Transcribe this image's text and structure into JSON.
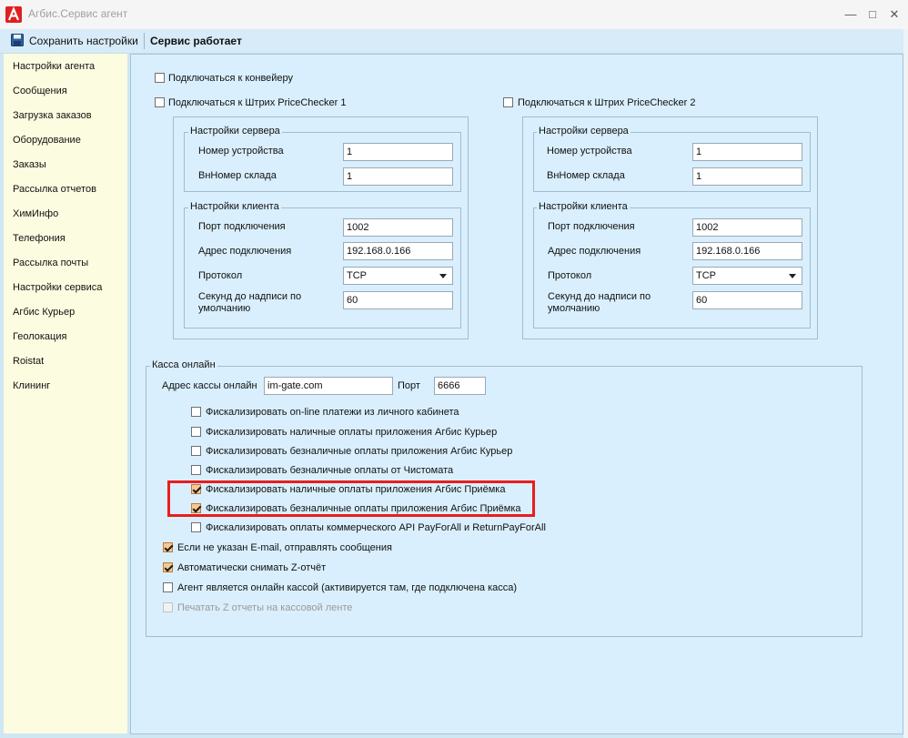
{
  "window": {
    "title": "Агбис.Сервис агент",
    "minimize": "—",
    "maximize": "□",
    "close": "✕"
  },
  "toolbar": {
    "save_label": "Сохранить настройки",
    "status": "Сервис работает"
  },
  "sidebar": {
    "items": [
      {
        "label": "Настройки агента"
      },
      {
        "label": "Сообщения"
      },
      {
        "label": "Загрузка заказов"
      },
      {
        "label": "Оборудование"
      },
      {
        "label": "Заказы"
      },
      {
        "label": "Рассылка отчетов"
      },
      {
        "label": "ХимИнфо"
      },
      {
        "label": "Телефония"
      },
      {
        "label": "Рассылка почты"
      },
      {
        "label": "Настройки сервиса"
      },
      {
        "label": "Агбис Курьер"
      },
      {
        "label": "Геолокация"
      },
      {
        "label": "Roistat"
      },
      {
        "label": "Клининг"
      }
    ]
  },
  "conveyor": {
    "label": "Подключаться к конвейеру",
    "checked": false
  },
  "pc1": {
    "label": "Подключаться к Штрих PriceChecker 1",
    "checked": false,
    "server": {
      "title": "Настройки сервера",
      "device_label": "Номер устройства",
      "device_value": "1",
      "warehouse_label": "ВнНомер склада",
      "warehouse_value": "1"
    },
    "client": {
      "title": "Настройки клиента",
      "port_label": "Порт подключения",
      "port_value": "1002",
      "addr_label": "Адрес подключения",
      "addr_value": "192.168.0.166",
      "proto_label": "Протокол",
      "proto_value": "TCP",
      "sec_label_1": "Секунд до надписи по",
      "sec_label_2": "умолчанию",
      "sec_value": "60"
    }
  },
  "pc2": {
    "label": "Подключаться к Штрих PriceChecker 2",
    "checked": false,
    "server": {
      "title": "Настройки сервера",
      "device_label": "Номер устройства",
      "device_value": "1",
      "warehouse_label": "ВнНомер склада",
      "warehouse_value": "1"
    },
    "client": {
      "title": "Настройки клиента",
      "port_label": "Порт подключения",
      "port_value": "1002",
      "addr_label": "Адрес подключения",
      "addr_value": "192.168.0.166",
      "proto_label": "Протокол",
      "proto_value": "TCP",
      "sec_label_1": "Секунд до надписи по",
      "sec_label_2": "умолчанию",
      "sec_value": "60"
    }
  },
  "kassa": {
    "title": "Касса онлайн",
    "addr_label": "Адрес кассы онлайн",
    "addr_value": "im-gate.com",
    "port_label": "Порт",
    "port_value": "6666",
    "options": [
      {
        "label": "Фискализировать on-line платежи из личного кабинета",
        "checked": false
      },
      {
        "label": "Фискализировать наличные оплаты приложения Агбис Курьер",
        "checked": false
      },
      {
        "label": "Фискализировать безналичные оплаты приложения Агбис Курьер",
        "checked": false
      },
      {
        "label": "Фискализировать безналичные оплаты от Чистомата",
        "checked": false
      },
      {
        "label": "Фискализировать наличные оплаты приложения Агбис Приёмка",
        "checked": true
      },
      {
        "label": "Фискализировать безналичные оплаты приложения Агбис Приёмка",
        "checked": true
      },
      {
        "label": "Фискализировать оплаты коммерческого API PayForAll и ReturnPayForAll",
        "checked": false
      }
    ],
    "email_label": "Если не указан E-mail, отправлять сообщения",
    "email_checked": true,
    "z_label": "Автоматически снимать Z-отчёт",
    "z_checked": true,
    "agent_label": "Агент является онлайн кассой (активируется там, где подключена касса)",
    "agent_checked": false,
    "print_label": "Печатать Z отчеты на кассовой ленте",
    "print_checked": false
  },
  "colors": {
    "highlight": "#ea1d1d",
    "sidebar_bg": "#fcfce0",
    "content_bg": "#d9effd",
    "check_fill": "#f6c892"
  }
}
